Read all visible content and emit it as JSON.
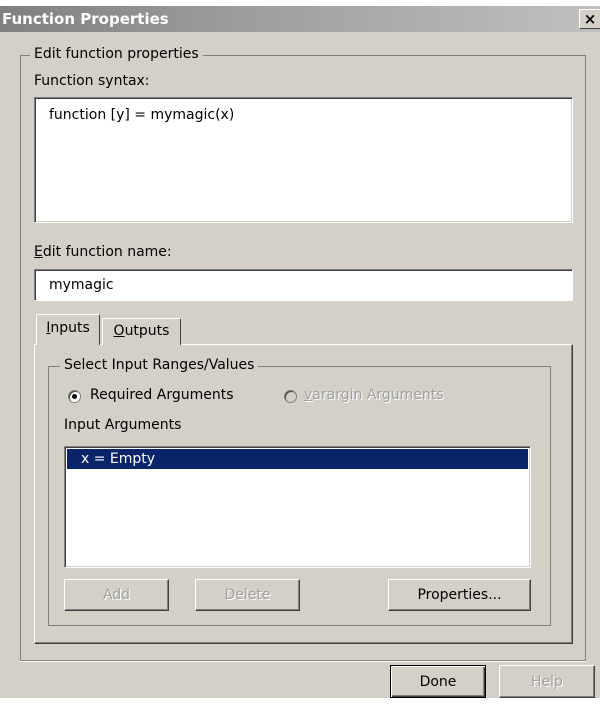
{
  "window": {
    "title": "Function Properties",
    "close_glyph": "×"
  },
  "edit_group": {
    "legend": "Edit function properties",
    "syntax_label": "Function syntax:",
    "syntax_value": "function [y] = mymagic(x)",
    "name_label_mnemonic": "E",
    "name_label_rest": "dit function name:",
    "name_value": "mymagic"
  },
  "tabs": [
    {
      "mnemonic": "I",
      "rest": "nputs",
      "selected": true
    },
    {
      "mnemonic": "O",
      "rest": "utputs",
      "selected": false
    }
  ],
  "inputs_tab": {
    "group_legend": "Select Input Ranges/Values",
    "radio_required": {
      "label": "Required Arguments",
      "checked": true,
      "enabled": true
    },
    "radio_varargin": {
      "mnemonic": "v",
      "rest": "arargin Arguments",
      "checked": false,
      "enabled": false
    },
    "list_label": "Input Arguments",
    "list_items": [
      "x = Empty"
    ],
    "buttons": {
      "add": "Add",
      "delete": "Delete",
      "properties": "Properties..."
    }
  },
  "footer": {
    "done": "Done",
    "help": "Help"
  },
  "colors": {
    "dialog_bg": "#d4d0c8",
    "title_gradient_start": "#808080",
    "selection_bg": "#0a246a",
    "disabled_text": "#a0a0a0"
  }
}
